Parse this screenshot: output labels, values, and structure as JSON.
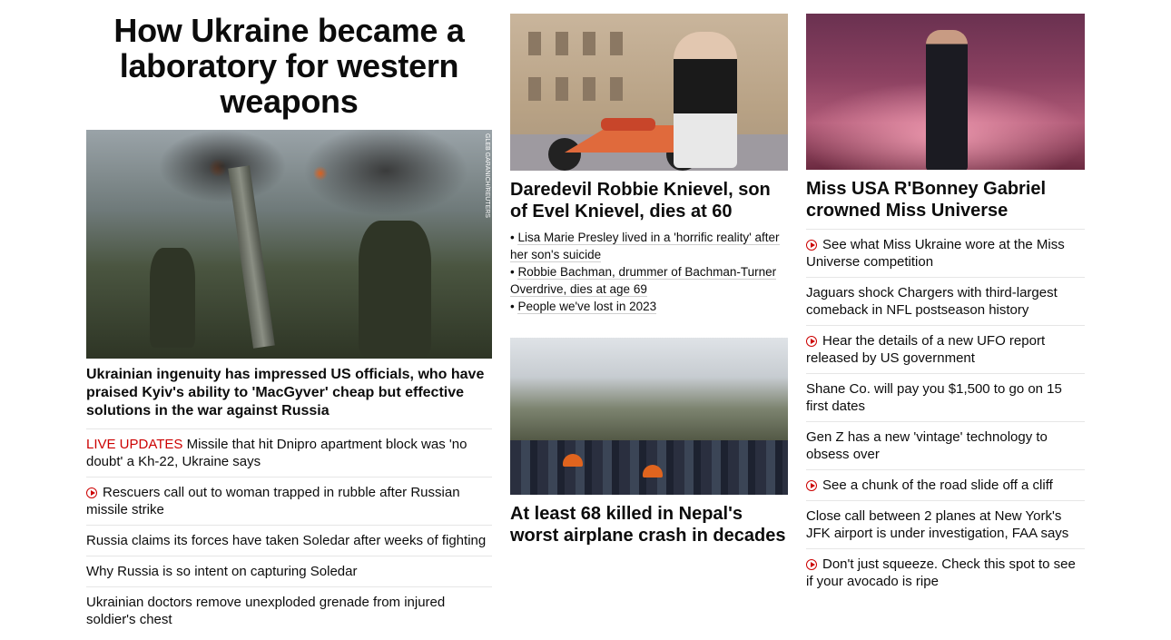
{
  "col1": {
    "title": "How Ukraine became a laboratory for western weapons",
    "photo_credit": "GLEB GARANICH/REUTERS",
    "lead": "Ukrainian ingenuity has impressed US officials, who have praised Kyiv's ability to 'MacGyver' cheap but effective solutions in the war against Russia",
    "headlines": [
      {
        "prefix": "LIVE UPDATES",
        "text": " Missile that hit Dnipro apartment block was 'no doubt' a Kh-22, Ukraine says",
        "video": false
      },
      {
        "prefix": "",
        "text": "Rescuers call out to woman trapped in rubble after Russian missile strike",
        "video": true
      },
      {
        "prefix": "",
        "text": "Russia claims its forces have taken Soledar after weeks of fighting",
        "video": false
      },
      {
        "prefix": "",
        "text": "Why Russia is so intent on capturing Soledar",
        "video": false
      },
      {
        "prefix": "",
        "text": "Ukrainian doctors remove unexploded grenade from injured soldier's chest",
        "video": false
      }
    ]
  },
  "col2": {
    "card1_title": "Daredevil Robbie Knievel, son of Evel Knievel, dies at 60",
    "bullets": [
      "Lisa Marie Presley lived in a 'horrific reality' after her son's suicide",
      "Robbie Bachman, drummer of Bachman-Turner Overdrive, dies at age 69",
      "People we've lost in 2023"
    ],
    "card2_title": "At least 68 killed in Nepal's worst airplane crash in decades"
  },
  "col3": {
    "title": "Miss USA R'Bonney Gabriel crowned Miss Universe",
    "headlines": [
      {
        "text": "See what Miss Ukraine wore at the Miss Universe competition",
        "video": true
      },
      {
        "text": "Jaguars shock Chargers with third-largest comeback in NFL postseason history",
        "video": false
      },
      {
        "text": "Hear the details of a new UFO report released by US government",
        "video": true
      },
      {
        "text": "Shane Co. will pay you $1,500 to go on 15 first dates",
        "video": false
      },
      {
        "text": "Gen Z has a new 'vintage' technology to obsess over",
        "video": false
      },
      {
        "text": "See a chunk of the road slide off a cliff",
        "video": true
      },
      {
        "text": "Close call between 2 planes at New York's JFK airport is under investigation, FAA says",
        "video": false
      },
      {
        "text": "Don't just squeeze. Check this spot to see if your avocado is ripe",
        "video": true
      }
    ]
  },
  "colors": {
    "live": "#cc0000",
    "text": "#0c0c0c",
    "divider": "#e6e6e6"
  }
}
